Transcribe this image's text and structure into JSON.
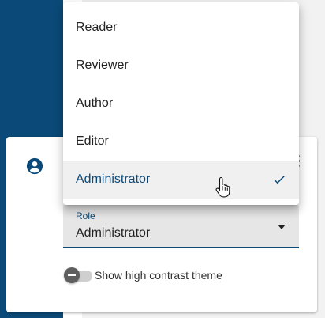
{
  "menu": {
    "items": [
      {
        "label": "Reader"
      },
      {
        "label": "Reviewer"
      },
      {
        "label": "Author"
      },
      {
        "label": "Editor"
      },
      {
        "label": "Administrator",
        "selected": true
      }
    ],
    "selected_icon": "check-icon"
  },
  "role_field": {
    "label": "Role",
    "value": "Administrator",
    "dropdown_icon": "caret-down-icon"
  },
  "account_icon": "account-circle-icon",
  "high_contrast_toggle": {
    "label": "Show high contrast theme",
    "checked": false
  },
  "colors": {
    "accent": "#0b4a78",
    "sidebar": "#0b4a78",
    "field_background": "#e6e6e6",
    "selected_item_background": "#f0f0f0"
  }
}
